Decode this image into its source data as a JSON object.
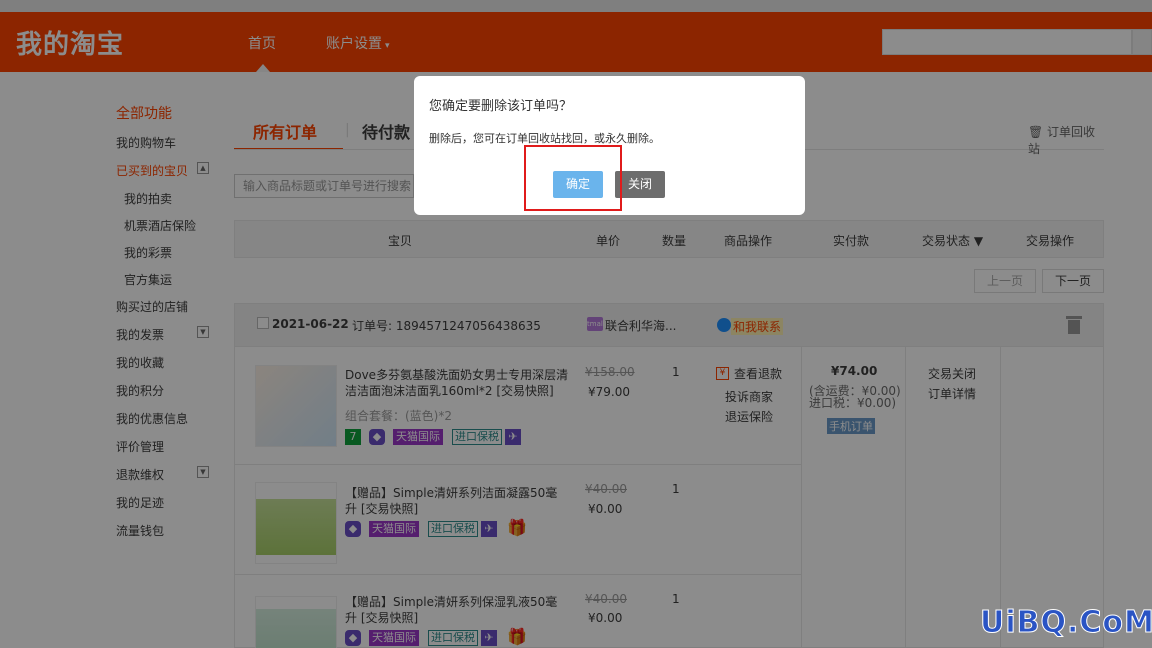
{
  "header": {
    "logo": "我的淘宝",
    "nav_home": "首页",
    "nav_account": "账户设置",
    "nav_account_arrow": "▾"
  },
  "sidebar": {
    "title": "全部功能",
    "items": [
      {
        "label": "我的购物车"
      },
      {
        "label": "已买到的宝贝",
        "active": true,
        "toggle": "▲"
      },
      {
        "label": "我的拍卖",
        "sub": true
      },
      {
        "label": "机票酒店保险",
        "sub": true
      },
      {
        "label": "我的彩票",
        "sub": true
      },
      {
        "label": "官方集运",
        "sub": true
      },
      {
        "label": "购买过的店铺"
      },
      {
        "label": "我的发票",
        "toggle": "▼"
      },
      {
        "label": "我的收藏"
      },
      {
        "label": "我的积分"
      },
      {
        "label": "我的优惠信息"
      },
      {
        "label": "评价管理"
      },
      {
        "label": "退款维权",
        "toggle": "▼"
      },
      {
        "label": "我的足迹"
      },
      {
        "label": "流量钱包"
      }
    ]
  },
  "tabs": {
    "all": "所有订单",
    "sep": "|",
    "pending": "待付款",
    "recycle": "🗑 订单回收站"
  },
  "search": {
    "placeholder": "输入商品标题或订单号进行搜索"
  },
  "table_head": {
    "item": "宝贝",
    "price": "单价",
    "qty": "数量",
    "goods_ops": "商品操作",
    "paid": "实付款",
    "status": "交易状态 ▼",
    "trade_ops": "交易操作"
  },
  "pager": {
    "prev": "上一页",
    "next": "下一页"
  },
  "order": {
    "date": "2021-06-22",
    "order_no": "订单号: 1894571247056438635",
    "shop_icon": "tmall",
    "shop": "联合利华海...",
    "contact": "和我联系",
    "total": "¥74.00",
    "shipping": "(含运费：¥0.00)",
    "tax": "进口税：¥0.00)",
    "mobile_badge": "手机订单",
    "status": "交易关闭",
    "detail": "订单详情",
    "items": [
      {
        "name": "Dove多芬氨基酸洗面奶女男士专用深层清洁洁面泡沫洁面乳160ml*2 [交易快照]",
        "sku": "组合套餐：(蓝色)*2",
        "orig_price": "¥158.00",
        "price": "¥79.00",
        "qty": "1",
        "refund_icon": "¥",
        "ops": [
          "查看退款",
          "投诉商家",
          "退运保险"
        ],
        "badges": [
          "7",
          "◆",
          "天猫国际",
          "进口保税",
          "✈"
        ]
      },
      {
        "name": "【赠品】Simple清妍系列洁面凝露50毫升 [交易快照]",
        "orig_price": "¥40.00",
        "price": "¥0.00",
        "qty": "1",
        "badges": [
          "◆",
          "天猫国际",
          "进口保税",
          "✈",
          "🎁"
        ]
      },
      {
        "name": "【赠品】Simple清妍系列保湿乳液50毫升 [交易快照]",
        "orig_price": "¥40.00",
        "price": "¥0.00",
        "qty": "1",
        "badges": [
          "◆",
          "天猫国际",
          "进口保税",
          "✈",
          "🎁"
        ]
      }
    ]
  },
  "modal": {
    "title": "您确定要删除该订单吗？",
    "text": "删除后，您可在订单回收站找回，或永久删除。",
    "ok": "确定",
    "close": "关闭"
  },
  "watermark": "UiBQ.CoM",
  "colors": {
    "brand": "#ff4400",
    "ok_button": "#6ab4ec",
    "close_button": "#6d6d6d",
    "highlight_box": "#e01b1b"
  }
}
